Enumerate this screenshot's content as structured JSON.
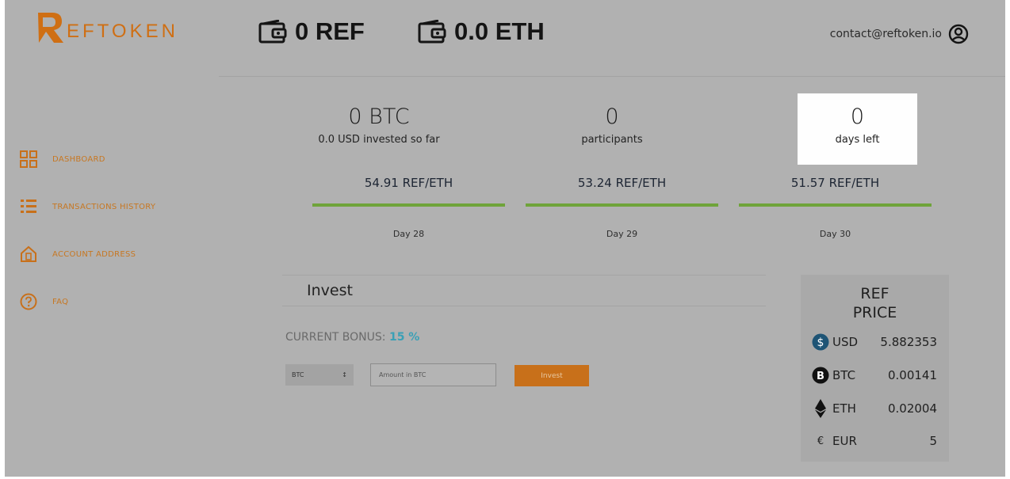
{
  "brand": {
    "name": "EFTOKEN"
  },
  "header": {
    "ref_balance": "0 REF",
    "eth_balance": "0.0 ETH",
    "contact": "contact@reftoken.io"
  },
  "sidebar": {
    "items": [
      {
        "label": "DASHBOARD",
        "icon": "dashboard-grid-icon"
      },
      {
        "label": "TRANSACTIONS HISTORY",
        "icon": "list-icon"
      },
      {
        "label": "ACCOUNT ADDRESS",
        "icon": "house-icon"
      },
      {
        "label": "FAQ",
        "icon": "question-icon"
      }
    ]
  },
  "stats": {
    "invested": {
      "value": "0 BTC",
      "label": "0.0 USD invested so far"
    },
    "participants": {
      "value": "0",
      "label": "participants"
    },
    "days_left": {
      "value": "0",
      "label": "days left"
    }
  },
  "schedule": [
    {
      "rate": "54.91 REF/ETH",
      "day": "Day 28"
    },
    {
      "rate": "53.24 REF/ETH",
      "day": "Day 29"
    },
    {
      "rate": "51.57 REF/ETH",
      "day": "Day 30"
    }
  ],
  "invest": {
    "title": "Invest",
    "bonus_label": "CURRENT BONUS:",
    "bonus_value": "15 %",
    "currency_selected": "BTC",
    "amount_placeholder": "Amount in BTC",
    "button_label": "Invest"
  },
  "price": {
    "title_line1": "REF",
    "title_line2": "PRICE",
    "rows": [
      {
        "currency": "USD",
        "value": "5.882353",
        "icon": "usd-coin-icon"
      },
      {
        "currency": "BTC",
        "value": "0.00141",
        "icon": "bitcoin-icon"
      },
      {
        "currency": "ETH",
        "value": "0.02004",
        "icon": "ethereum-icon"
      },
      {
        "currency": "EUR",
        "value": "5",
        "icon": "euro-icon"
      }
    ]
  },
  "colors": {
    "accent": "#c8701a",
    "progress": "#6fa43a",
    "bonus": "#3aa0b6",
    "background": "#b1b1b1"
  }
}
